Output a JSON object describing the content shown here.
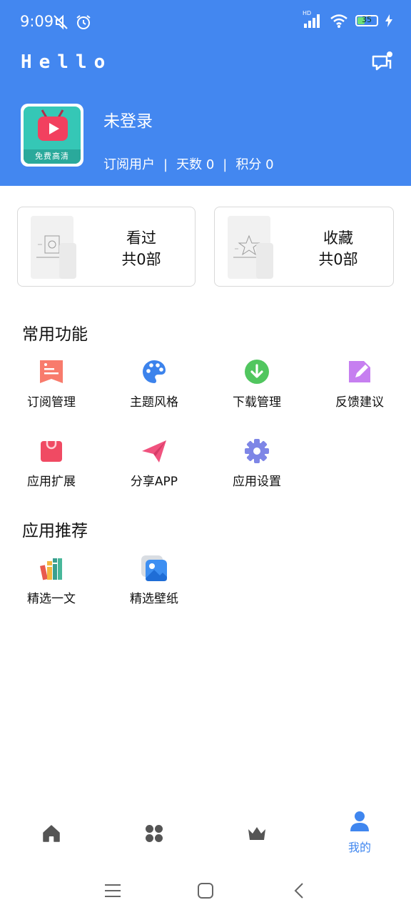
{
  "status": {
    "time": "9:09",
    "battery": "35",
    "hd_label": "HD"
  },
  "header": {
    "greeting": "Hello",
    "avatar_caption": "免费高清",
    "user_name": "未登录",
    "meta": {
      "subscription": "订阅用户",
      "days_label": "天数",
      "days": "0",
      "points_label": "积分",
      "points": "0",
      "separator": "|"
    }
  },
  "cards": [
    {
      "title": "看过",
      "subtitle": "共0部"
    },
    {
      "title": "收藏",
      "subtitle": "共0部"
    }
  ],
  "common": {
    "title": "常用功能",
    "items": [
      {
        "label": "订阅管理",
        "icon": "subscription-icon",
        "color": "#f87b6c"
      },
      {
        "label": "主题风格",
        "icon": "palette-icon",
        "color": "#3c83ec"
      },
      {
        "label": "下载管理",
        "icon": "download-icon",
        "color": "#51c65f"
      },
      {
        "label": "反馈建议",
        "icon": "edit-icon",
        "color": "#c67ff0"
      },
      {
        "label": "应用扩展",
        "icon": "shopping-bag-icon",
        "color": "#f04a63"
      },
      {
        "label": "分享APP",
        "icon": "paper-plane-icon",
        "color": "#f0527e"
      },
      {
        "label": "应用设置",
        "icon": "gear-icon",
        "color": "#7e86e6"
      }
    ]
  },
  "recommend": {
    "title": "应用推荐",
    "items": [
      {
        "label": "精选一文",
        "icon": "books-icon"
      },
      {
        "label": "精选壁纸",
        "icon": "wallpaper-icon"
      }
    ]
  },
  "bottom_nav": {
    "active_label": "我的",
    "items": [
      "home-icon",
      "apps-icon",
      "crown-icon",
      "profile-icon"
    ],
    "accent": "#3f86ef"
  },
  "colors": {
    "brand": "#4387f0"
  }
}
